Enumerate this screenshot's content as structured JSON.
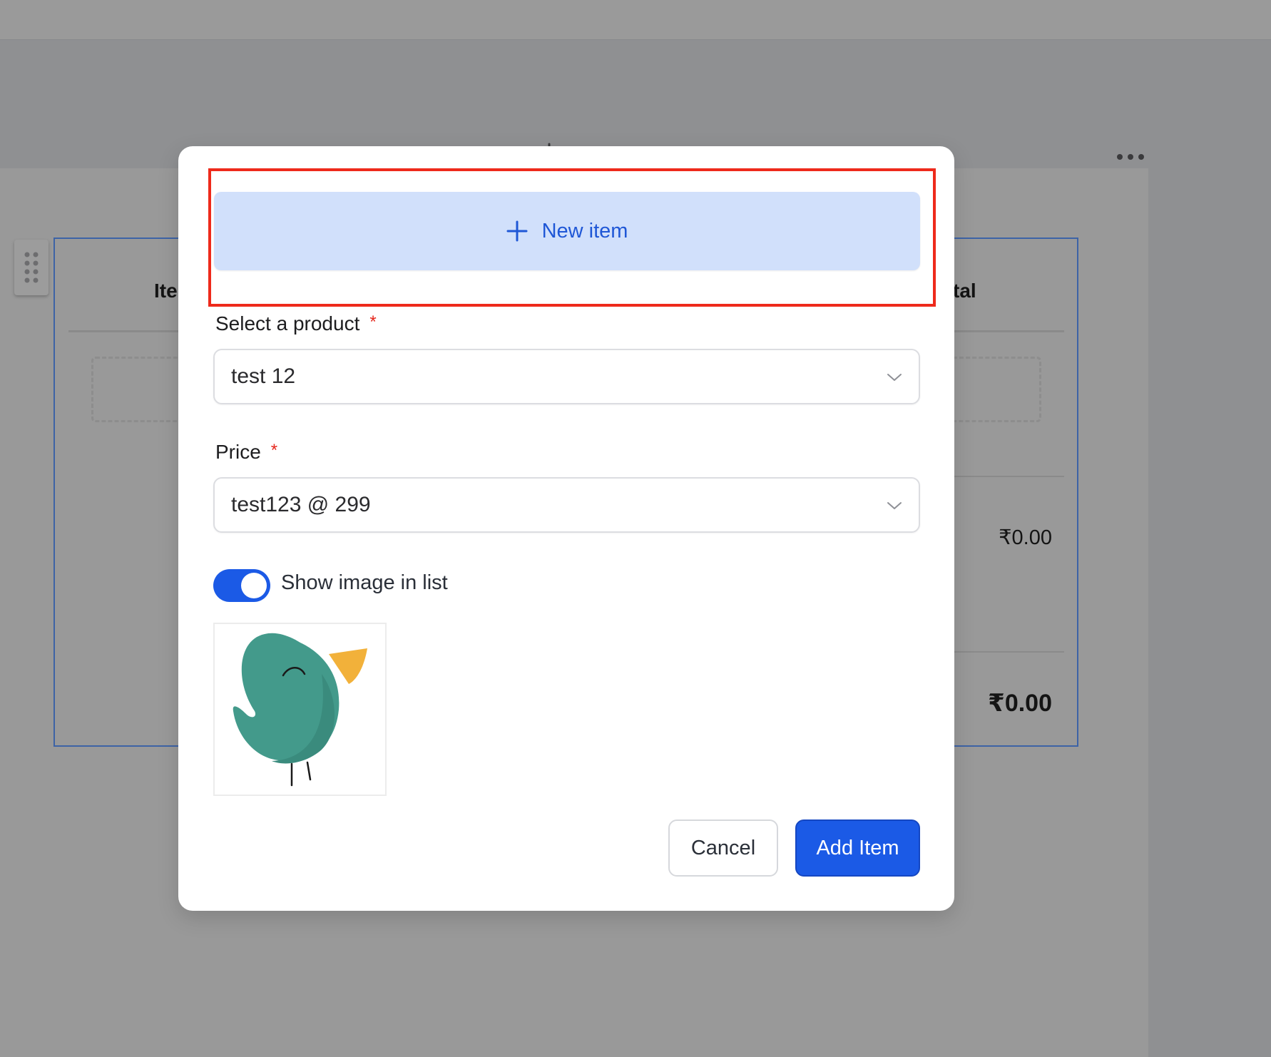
{
  "background": {
    "table": {
      "header_left": "Ite",
      "header_right": "tal",
      "row_total": "₹0.00",
      "grand_total": "₹0.00"
    },
    "icons": {
      "add": "plus-icon",
      "more": "more-horizontal-icon",
      "drag": "drag-handle-icon"
    }
  },
  "modal": {
    "new_item_label": "New item",
    "product": {
      "label": "Select a product",
      "required_mark": "*",
      "value": "test 12"
    },
    "price": {
      "label": "Price",
      "required_mark": "*",
      "value": "test123 @ 299"
    },
    "show_image": {
      "label": "Show image in list",
      "checked": true
    },
    "cancel_label": "Cancel",
    "add_label": "Add Item"
  },
  "colors": {
    "accent": "#1b5ae6",
    "highlight": "#ee2a1b",
    "new_item_bg": "#d1e0fb",
    "required": "#e5261c"
  }
}
